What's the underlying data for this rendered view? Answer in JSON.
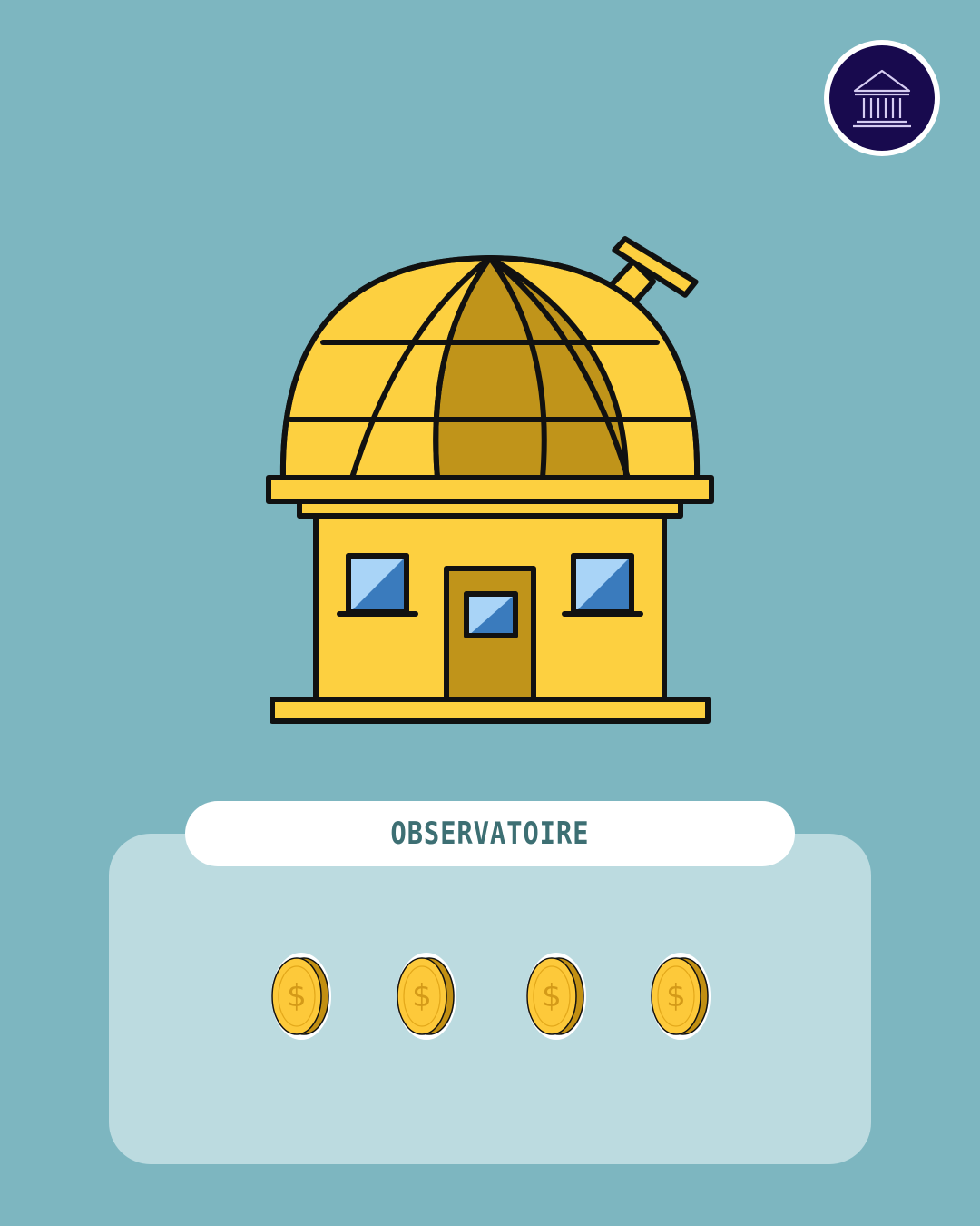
{
  "badge": {
    "icon": "museum-icon",
    "color": "#180a4e"
  },
  "building": {
    "icon": "observatory-icon",
    "dome_color": "#c0941a",
    "wall_color": "#fdd040",
    "window_color": "#a9d4f7"
  },
  "card": {
    "title": "OBSERVATOIRE",
    "title_color": "#3d6f73"
  },
  "cost": {
    "coins": 4,
    "coin_icon": "dollar-coin-icon",
    "coin_symbol": "$"
  }
}
